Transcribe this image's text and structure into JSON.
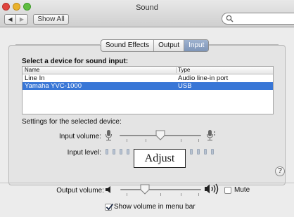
{
  "window": {
    "title": "Sound"
  },
  "toolbar": {
    "show_all_label": "Show All",
    "search_placeholder": ""
  },
  "tabs": [
    {
      "label": "Sound Effects",
      "active": false
    },
    {
      "label": "Output",
      "active": false
    },
    {
      "label": "Input",
      "active": true
    }
  ],
  "input": {
    "select_label": "Select a device for sound input:",
    "columns": [
      "Name",
      "Type"
    ],
    "devices": [
      {
        "name": "Line In",
        "type": "Audio line-in port",
        "selected": false
      },
      {
        "name": "Yamaha YVC-1000",
        "type": "USB",
        "selected": true
      }
    ],
    "settings_label": "Settings for the selected device:",
    "volume_label": "Input volume:",
    "volume_fraction": 0.5,
    "level_label": "Input level:",
    "tooltip": "Adjust"
  },
  "output": {
    "volume_label": "Output volume:",
    "volume_fraction": 0.3,
    "mute_label": "Mute",
    "mute_checked": false,
    "show_volume_label": "Show volume in menu bar",
    "show_volume_checked": true
  },
  "help_label": "?",
  "colors": {
    "accent": "#3876d6",
    "tab_active": "#8ba0c2"
  }
}
